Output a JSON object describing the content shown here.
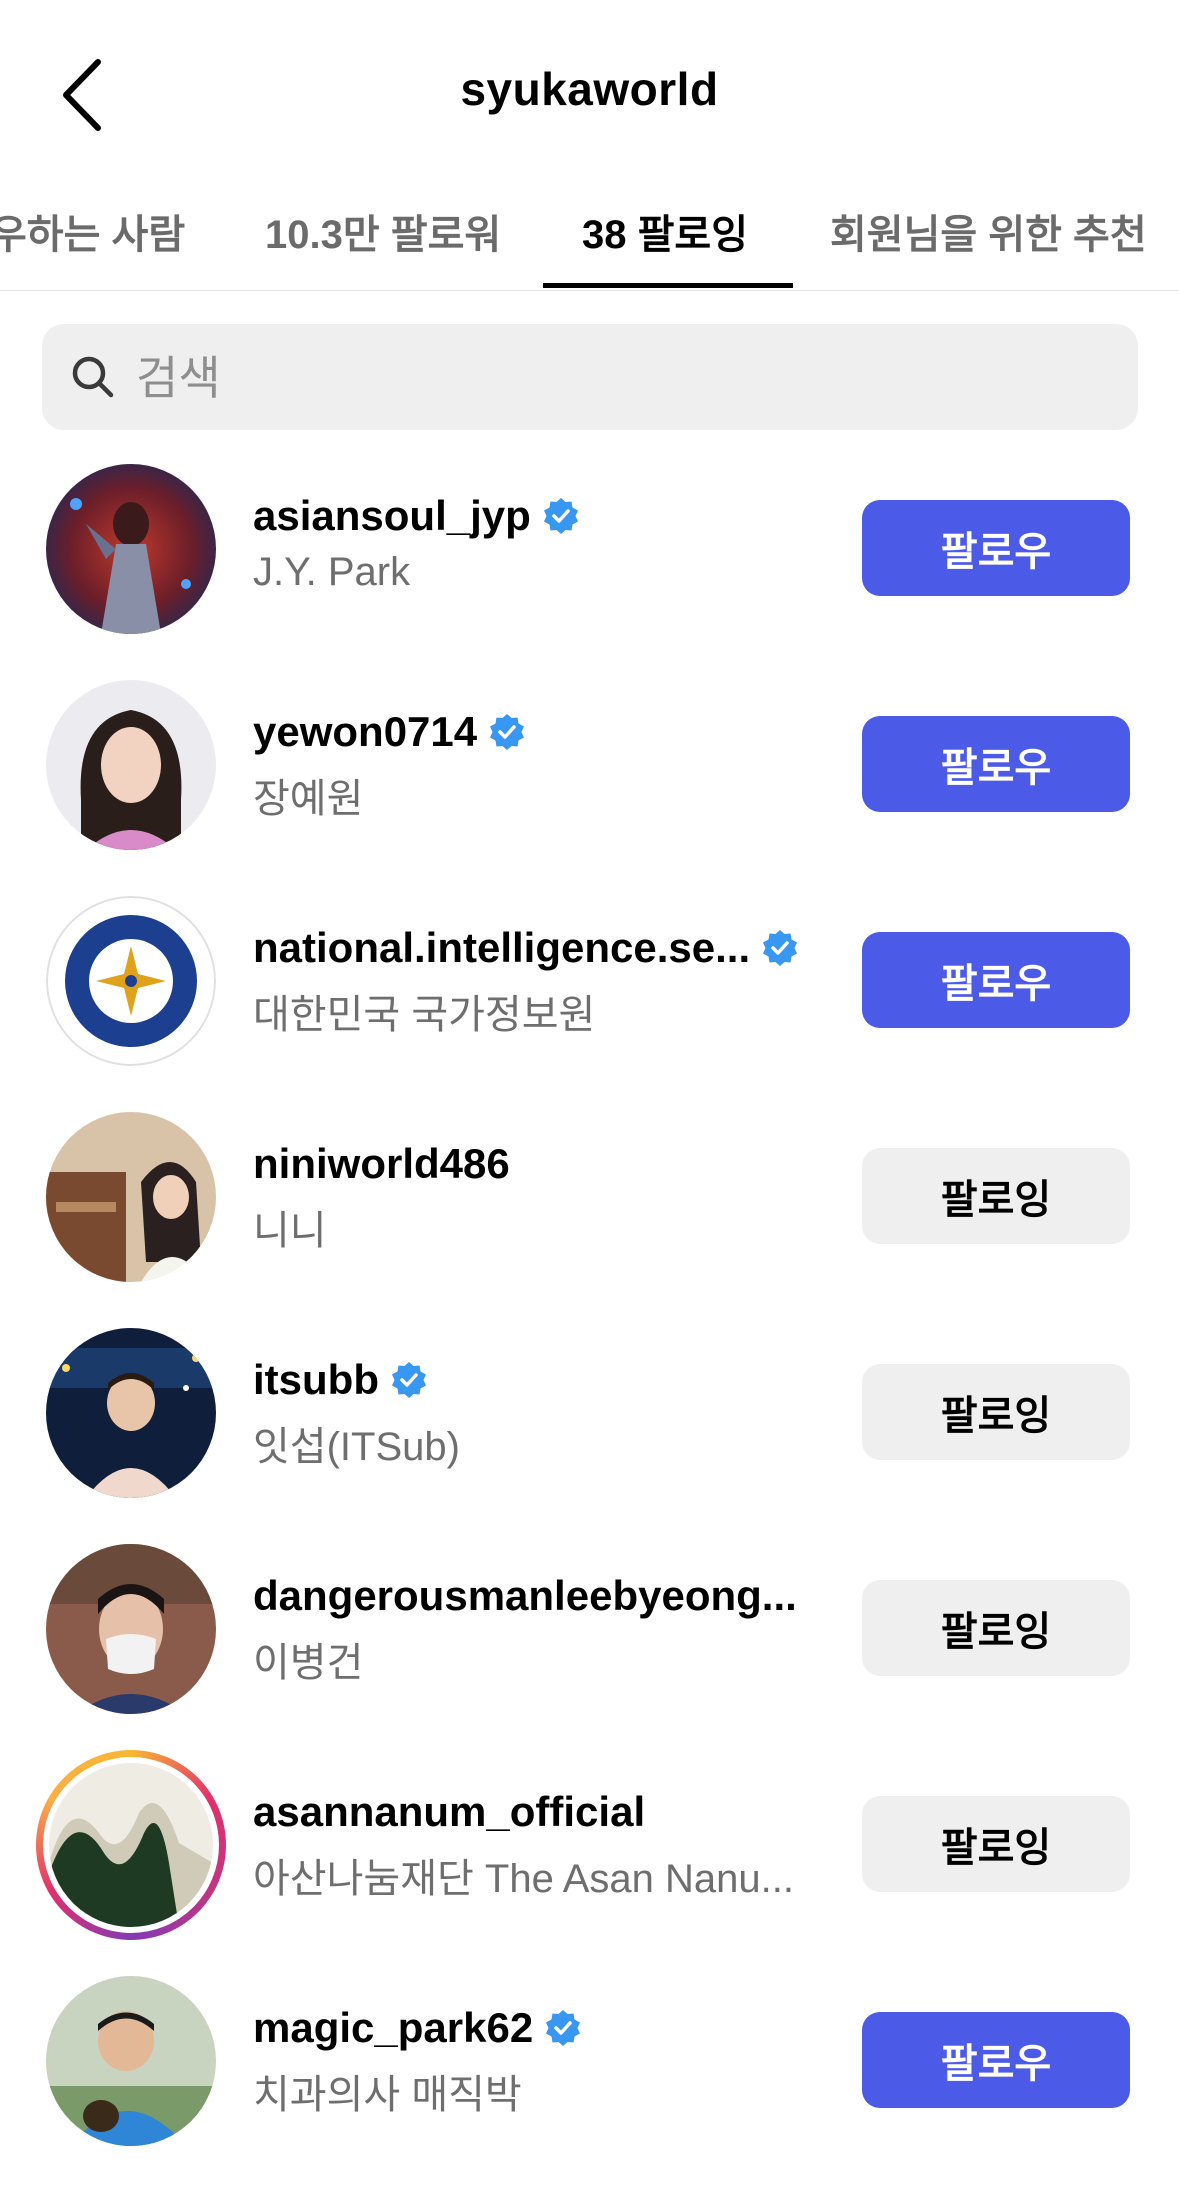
{
  "header": {
    "title": "syukaworld",
    "back_icon": "chevron-left-icon"
  },
  "tabs": [
    {
      "label": "우하는 사람",
      "active": false
    },
    {
      "label": "10.3만 팔로워",
      "active": false
    },
    {
      "label": "38 팔로잉",
      "active": true
    },
    {
      "label": "회원님을 위한 추천",
      "active": false
    }
  ],
  "search": {
    "placeholder": "검색",
    "value": "",
    "icon": "search-icon"
  },
  "accent_color": "#4c5ae8",
  "verified_color": "#3897f0",
  "users": [
    {
      "username": "asiansoul_jyp",
      "full_name": "J.Y. Park",
      "verified": true,
      "button": "팔로우"
    },
    {
      "username": "yewon0714",
      "full_name": "장예원",
      "verified": true,
      "button": "팔로우"
    },
    {
      "username": "national.intelligence.se...",
      "full_name": "대한민국 국가정보원",
      "verified": true,
      "button": "팔로우"
    },
    {
      "username": "niniworld486",
      "full_name": "니니",
      "verified": false,
      "button": "팔로잉"
    },
    {
      "username": "itsubb",
      "full_name": "잇섭(ITSub)",
      "verified": true,
      "button": "팔로잉"
    },
    {
      "username": "dangerousmanleebyeong...",
      "full_name": "이병건",
      "verified": false,
      "button": "팔로잉"
    },
    {
      "username": "asannanum_official",
      "full_name": "아산나눔재단 The Asan Nanu...",
      "verified": false,
      "button": "팔로잉"
    },
    {
      "username": "magic_park62",
      "full_name": "치과의사 매직박",
      "verified": true,
      "button": "팔로우"
    }
  ]
}
